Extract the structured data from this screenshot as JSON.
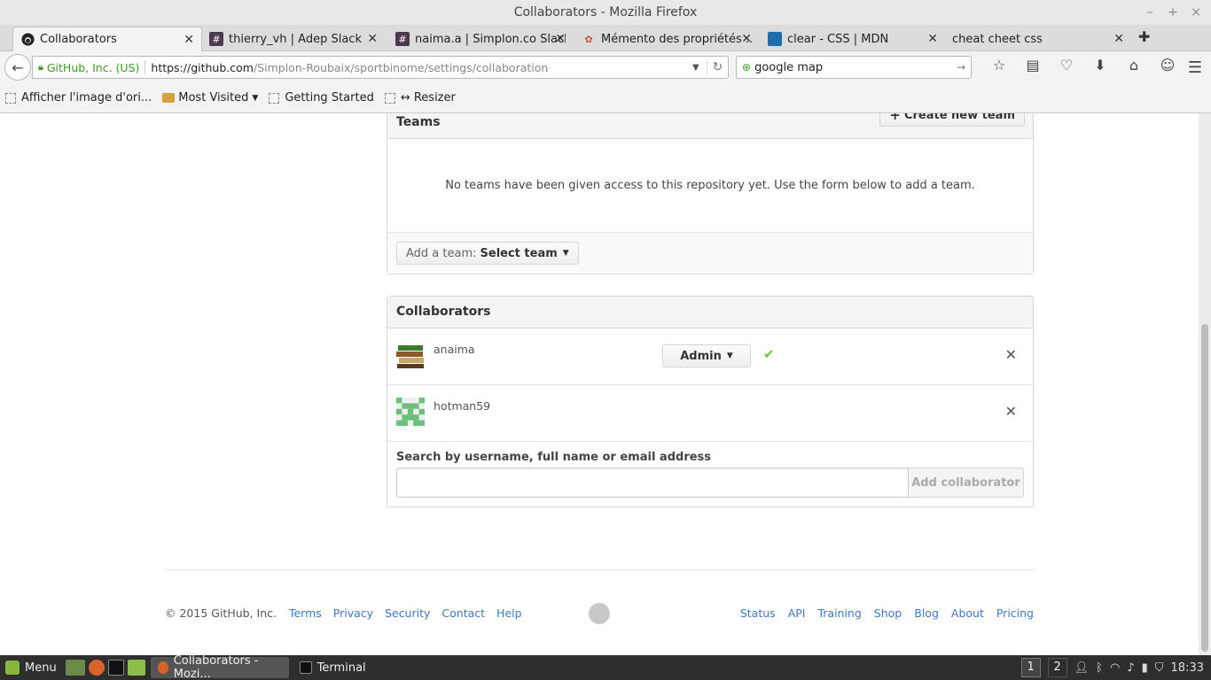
{
  "window": {
    "title": "Collaborators - Mozilla Firefox"
  },
  "tabs": [
    {
      "label": "Collaborators",
      "icon": "github-icon",
      "active": true
    },
    {
      "label": "thierry_vh | Adep Slack",
      "icon": "slack-icon"
    },
    {
      "label": "naima.a | Simplon.co Slack",
      "icon": "slack-icon"
    },
    {
      "label": "Mémento des propriétés ...",
      "icon": "memento-icon"
    },
    {
      "label": "clear - CSS | MDN",
      "icon": "mdn-icon"
    },
    {
      "label": "cheat cheet css",
      "icon": "blank-icon"
    }
  ],
  "nav": {
    "identity": "GitHub, Inc. (US)",
    "url_host": "https://github.com",
    "url_path": "/Simplon-Roubaix/sportbinome/settings/collaboration",
    "search_value": "google map"
  },
  "bookmarks": [
    {
      "label": "Afficher l'image d'ori...",
      "type": "page"
    },
    {
      "label": "Most Visited",
      "type": "folder"
    },
    {
      "label": "Getting Started",
      "type": "page"
    },
    {
      "label": "↔ Resizer",
      "type": "page"
    }
  ],
  "teams": {
    "title": "Teams",
    "create_label": "Create new team",
    "empty_message": "No teams have been given access to this repository yet. Use the form below to add a team.",
    "add_prefix": "Add a team:",
    "select_label": "Select team"
  },
  "collaborators": {
    "title": "Collaborators",
    "people": [
      {
        "name": "anaima",
        "role": "Admin"
      },
      {
        "name": "hotman59"
      }
    ],
    "search_label": "Search by username, full name or email address",
    "add_label": "Add collaborator"
  },
  "footer": {
    "copyright": "© 2015 GitHub, Inc.",
    "left_links": [
      "Terms",
      "Privacy",
      "Security",
      "Contact",
      "Help"
    ],
    "right_links": [
      "Status",
      "API",
      "Training",
      "Shop",
      "Blog",
      "About",
      "Pricing"
    ]
  },
  "taskbar": {
    "menu_label": "Menu",
    "tasks": [
      "Collaborators - Mozi...",
      "Terminal"
    ],
    "workspaces": [
      "1",
      "2"
    ],
    "clock": "18:33"
  },
  "colors": {
    "link": "#4078c0",
    "check": "#6cc644",
    "secure": "#3a9d23"
  }
}
